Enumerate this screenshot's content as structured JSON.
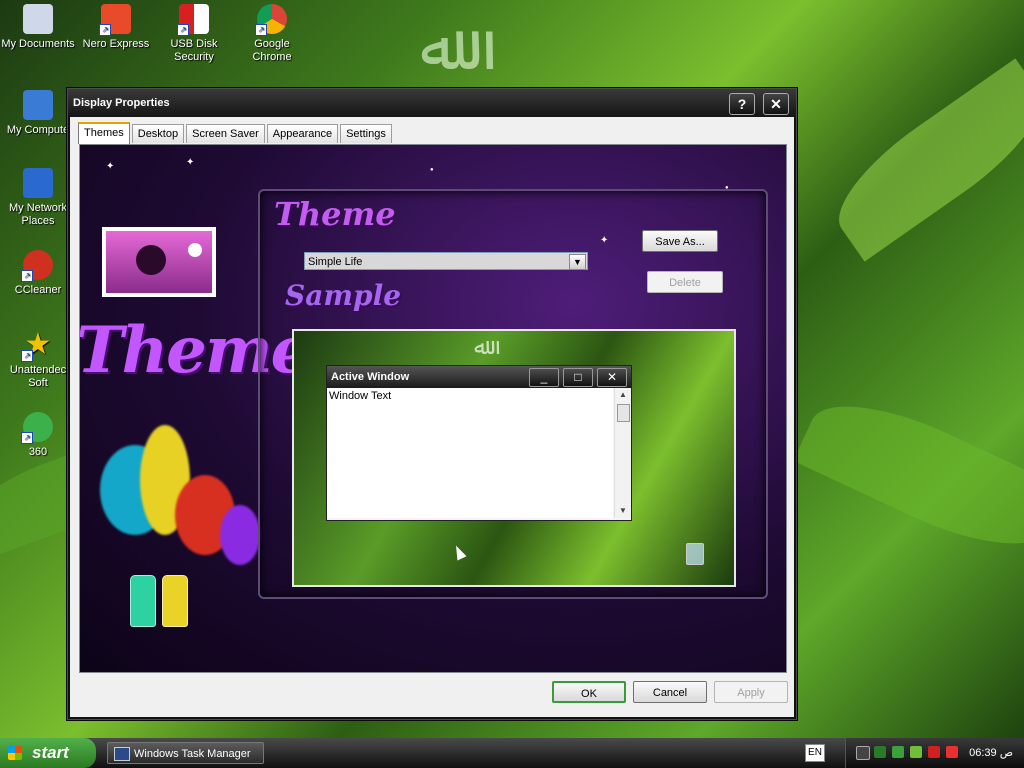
{
  "desktop": {
    "icons": [
      {
        "label": "My Documents",
        "icon": "my-documents-icon",
        "color": "#cfd8e8"
      },
      {
        "label": "Nero Express",
        "icon": "nero-express-icon",
        "color": "#e84a2a"
      },
      {
        "label": "USB Disk Security",
        "icon": "usb-disk-security-icon",
        "color": "#d92020"
      },
      {
        "label": "Google Chrome",
        "icon": "chrome-icon",
        "color": "#f4b400"
      },
      {
        "label": "My Compute",
        "icon": "my-computer-icon",
        "color": "#3a7bd5"
      },
      {
        "label": "My Network Places",
        "icon": "network-places-icon",
        "color": "#2a6acf"
      },
      {
        "label": "CCleaner",
        "icon": "ccleaner-icon",
        "color": "#d03020"
      },
      {
        "label": "Unattendec Soft",
        "icon": "star-icon",
        "color": "#f2c200"
      },
      {
        "label": "360",
        "icon": "360-icon",
        "color": "#3cb04a"
      }
    ]
  },
  "dialog": {
    "title": "Display Properties",
    "help": "?",
    "close": "✕",
    "tabs": [
      {
        "label": "Themes",
        "active": true
      },
      {
        "label": "Desktop",
        "active": false
      },
      {
        "label": "Screen Saver",
        "active": false
      },
      {
        "label": "Appearance",
        "active": false
      },
      {
        "label": "Settings",
        "active": false
      }
    ],
    "banner_text": "Themes",
    "theme_label": "Theme",
    "sample_label": "Sample",
    "theme_select": "Simple Life",
    "save_as": "Save As...",
    "delete": "Delete",
    "preview": {
      "window_title": "Active Window",
      "window_text": "Window Text",
      "min": "_",
      "max": "□",
      "close": "✕"
    },
    "ok": "OK",
    "cancel": "Cancel",
    "apply": "Apply"
  },
  "taskbar": {
    "start": "start",
    "task_item": "Windows Task Manager",
    "language": "EN",
    "clock": "06:39 ص"
  },
  "colors": {
    "tab_accent": "#e8a000",
    "theme_purple": "#c357ff",
    "start_green": "#3f9a35"
  }
}
